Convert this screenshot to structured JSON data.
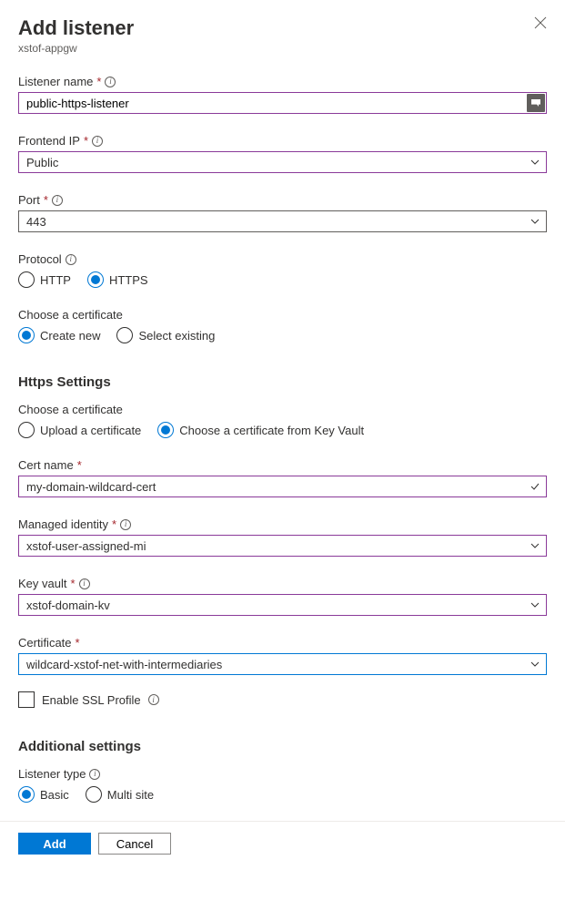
{
  "header": {
    "title": "Add listener",
    "resource": "xstof-appgw"
  },
  "fields": {
    "listenerName": {
      "label": "Listener name",
      "value": "public-https-listener"
    },
    "frontendIp": {
      "label": "Frontend IP",
      "value": "Public"
    },
    "port": {
      "label": "Port",
      "value": "443"
    },
    "protocol": {
      "label": "Protocol",
      "options": {
        "http": "HTTP",
        "https": "HTTPS"
      }
    },
    "chooseCert1": {
      "label": "Choose a certificate",
      "options": {
        "createNew": "Create new",
        "selectExisting": "Select existing"
      }
    },
    "httpsSettingsHeading": "Https Settings",
    "chooseCert2": {
      "label": "Choose a certificate",
      "options": {
        "upload": "Upload a certificate",
        "keyvault": "Choose a certificate from Key Vault"
      }
    },
    "certName": {
      "label": "Cert name",
      "value": "my-domain-wildcard-cert"
    },
    "managedIdentity": {
      "label": "Managed identity",
      "value": "xstof-user-assigned-mi"
    },
    "keyVault": {
      "label": "Key vault",
      "value": "xstof-domain-kv"
    },
    "certificate": {
      "label": "Certificate",
      "value": "wildcard-xstof-net-with-intermediaries"
    },
    "enableSsl": {
      "label": "Enable SSL Profile"
    },
    "additionalHeading": "Additional settings",
    "listenerType": {
      "label": "Listener type",
      "options": {
        "basic": "Basic",
        "multi": "Multi site"
      }
    }
  },
  "footer": {
    "add": "Add",
    "cancel": "Cancel"
  }
}
